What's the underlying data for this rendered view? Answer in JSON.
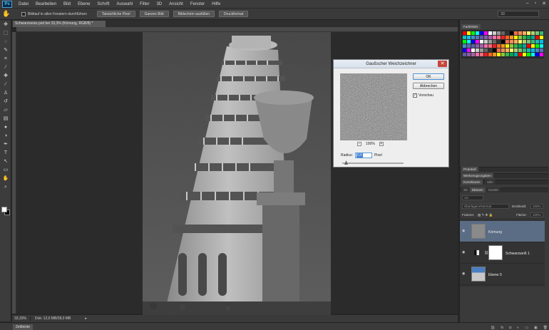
{
  "app": {
    "logo": "Ps"
  },
  "menu": [
    "Datei",
    "Bearbeiten",
    "Bild",
    "Ebene",
    "Schrift",
    "Auswahl",
    "Filter",
    "3D",
    "Ansicht",
    "Fenster",
    "Hilfe"
  ],
  "options_bar": {
    "scroll_all_label": "Bildlauf in allen Fenstern durchführen",
    "btn_actual": "Tatsächliche Pixel",
    "btn_whole": "Ganzes Bild",
    "btn_fill": "Bildschirm ausfüllen",
    "btn_print": "Druckformat",
    "workspace": "3D"
  },
  "document": {
    "tab_title": "Schwarzweiss.psd bei 33,3% (Körnung, RGB/8) *",
    "zoom": "33,33%",
    "doc_info": "Dok: 12,0 MB/28,0 MB"
  },
  "timeline": {
    "label": "Zeitleiste"
  },
  "dialog": {
    "title": "Gaußscher Weichzeichner",
    "ok": "OK",
    "cancel": "Abbrechen",
    "preview_label": "Vorschau",
    "preview_checked": "✓",
    "zoom_percent": "100%",
    "zoom_minus": "−",
    "zoom_plus": "+",
    "radius_label": "Radius:",
    "radius_value": "0,6",
    "radius_unit": "Pixel"
  },
  "panels": {
    "swatches_tab": "Farbfelder",
    "protocol_tab": "Protokoll",
    "tool_presets_tab": "Werkzeugvorgaben",
    "corrections_tab": "Korrekturen",
    "styles_tab": "Stile",
    "tab_3d": "3D",
    "tab_layers": "Ebenen",
    "tab_channels": "Kanäle",
    "kind_label": "Art",
    "blend_mode": "Überlagern/Normal",
    "opacity_label": "Deckkraft:",
    "opacity_value": "100%",
    "fix_label": "Fixieren:",
    "fill_label": "Fläche:",
    "fill_value": "100%"
  },
  "layers": [
    {
      "name": "Körnung",
      "selected": true
    },
    {
      "name": "Schwarzweiß 1",
      "selected": false
    },
    {
      "name": "Ebene 0",
      "selected": false
    }
  ],
  "colors": {
    "accent": "#5b6c85",
    "close": "#c8453a",
    "ok_border": "#4a90d9"
  }
}
